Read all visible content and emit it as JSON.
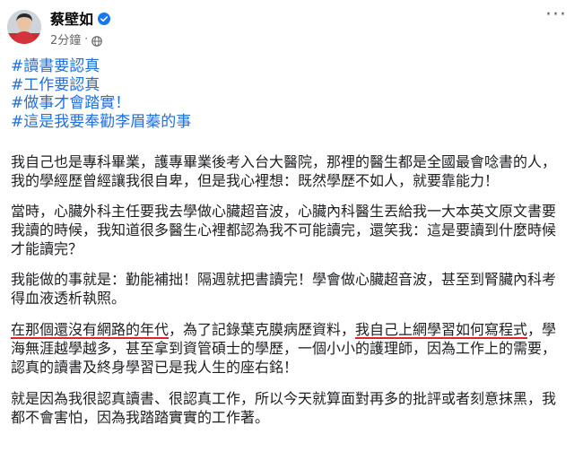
{
  "post": {
    "author": "蔡壁如",
    "time": "2分鐘",
    "separator": "·",
    "more_label": "···",
    "hashtags": [
      "#讀書要認真",
      "#工作要認真",
      "#做事才會踏實！",
      "#這是我要奉勸李眉蓁的事"
    ],
    "paragraphs": {
      "p1": "我自己也是專科畢業，護專畢業後考入台大醫院，那裡的醫生都是全國最會唸書的人，我的學經歷曾經讓我很自卑，但是我心裡想：既然學歷不如人，就要靠能力！",
      "p2": "當時，心臟外科主任要我去學做心臟超音波，心臟內科醫生丟給我一大本英文原文書要我讀的時候，我知道很多醫生心裡都認為我不可能讀完，還笑我：這是要讀到什麼時候才能讀完？",
      "p3": "我能做的事就是：勤能補拙！隔週就把書讀完！學會做心臟超音波，甚至到腎臟內科考得血液透析執照。",
      "p4_a": "在那個還沒有網路的年代",
      "p4_b": "，為了記錄葉克膜病歷資料，",
      "p4_c": "我自己上網學習如何寫程式",
      "p4_d": "，學海無涯越學越多，甚至拿到資管碩士的學歷，一個小小的護理師，因為工作上的需要，認真的讀書及終身學習已是我人生的座右銘！",
      "p5": "就是因為我很認真讀書、很認真工作，所以今天就算面對再多的批評或者刻意抹黑，我都不會害怕，因為我踏踏實實的工作著。"
    }
  },
  "colors": {
    "hashtag": "#216fdb",
    "verified": "#1877f2",
    "underline": "#d9262f",
    "text": "#1c1e21",
    "secondary": "#65676b"
  },
  "icons": {
    "verified": "verified-badge-icon",
    "audience": "globe-icon",
    "more": "more-options-icon"
  }
}
